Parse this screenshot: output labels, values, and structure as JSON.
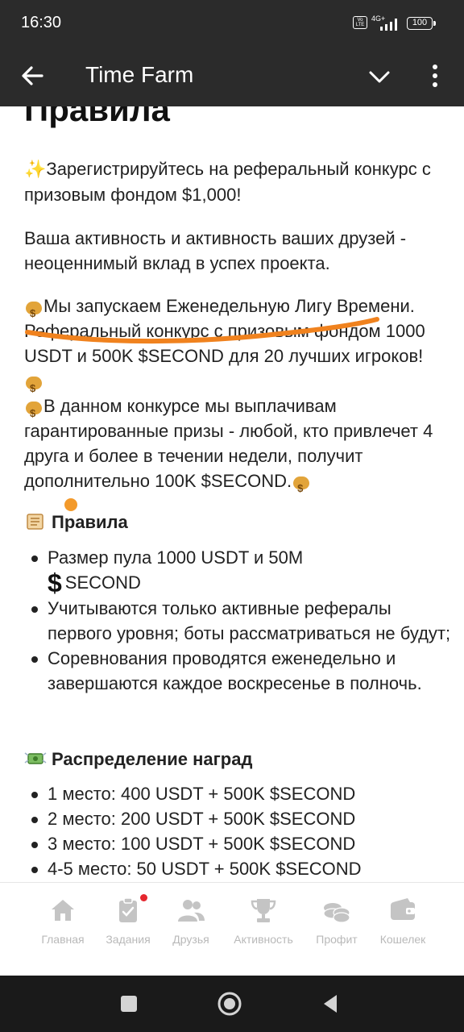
{
  "status_bar": {
    "time": "16:30",
    "volte": "Vo LTE",
    "network": "4G+",
    "battery": "100"
  },
  "header": {
    "title": "Time Farm",
    "back_icon": "arrow-left-icon",
    "chevron_icon": "chevron-down-icon",
    "more_icon": "more-vertical-icon"
  },
  "content": {
    "heading": "Правила",
    "intro": "Зарегистрируйтесь на реферальный конкурс с призовым фондом $1,000!",
    "activity": "Ваша активность и активность ваших друзей - неоценнимый вклад в успех проекта.",
    "league": "Мы запускаем Еженедельную Лигу Времени. Реферальный конкурс с призовым фондом 1000 USDT и 500K $SECOND для 20 лучших игроков!",
    "guarantee": "В данном конкурсе мы выплачивам гарантированные призы - любой, кто привлечет 4 друга и более в течении недели, получит дополнительно 100K $SECOND.",
    "rules_title": "Правила",
    "rules": {
      "pool_prefix": "Размер пула 1000 USDT и 50M",
      "pool_suffix": "SECOND",
      "item2": "Учитываются только активные рефералы первого уровня; боты рассматриваться не будут;",
      "item3": "Соревнования проводятся еженедельно и завершаются каждое воскресенье в полночь."
    },
    "rewards_title": "Распределение наград",
    "rewards": [
      "1 место: 400 USDT + 500K $SECOND",
      "2 место: 200 USDT + 500K $SECOND",
      "3 место: 100 USDT + 500K $SECOND",
      "4-5 место: 50 USDT + 500K $SECOND"
    ]
  },
  "bottom_nav": [
    {
      "label": "Главная",
      "icon": "home-icon"
    },
    {
      "label": "Задания",
      "icon": "tasks-icon",
      "badge": true
    },
    {
      "label": "Друзья",
      "icon": "friends-icon"
    },
    {
      "label": "Активность",
      "icon": "trophy-icon"
    },
    {
      "label": "Профит",
      "icon": "coins-icon"
    },
    {
      "label": "Кошелек",
      "icon": "wallet-icon"
    }
  ],
  "colors": {
    "header_bg": "#2b2b2b",
    "nav_inactive": "#b9b9b9",
    "badge": "#e5262e",
    "annotation_stroke": "#f0821e"
  }
}
